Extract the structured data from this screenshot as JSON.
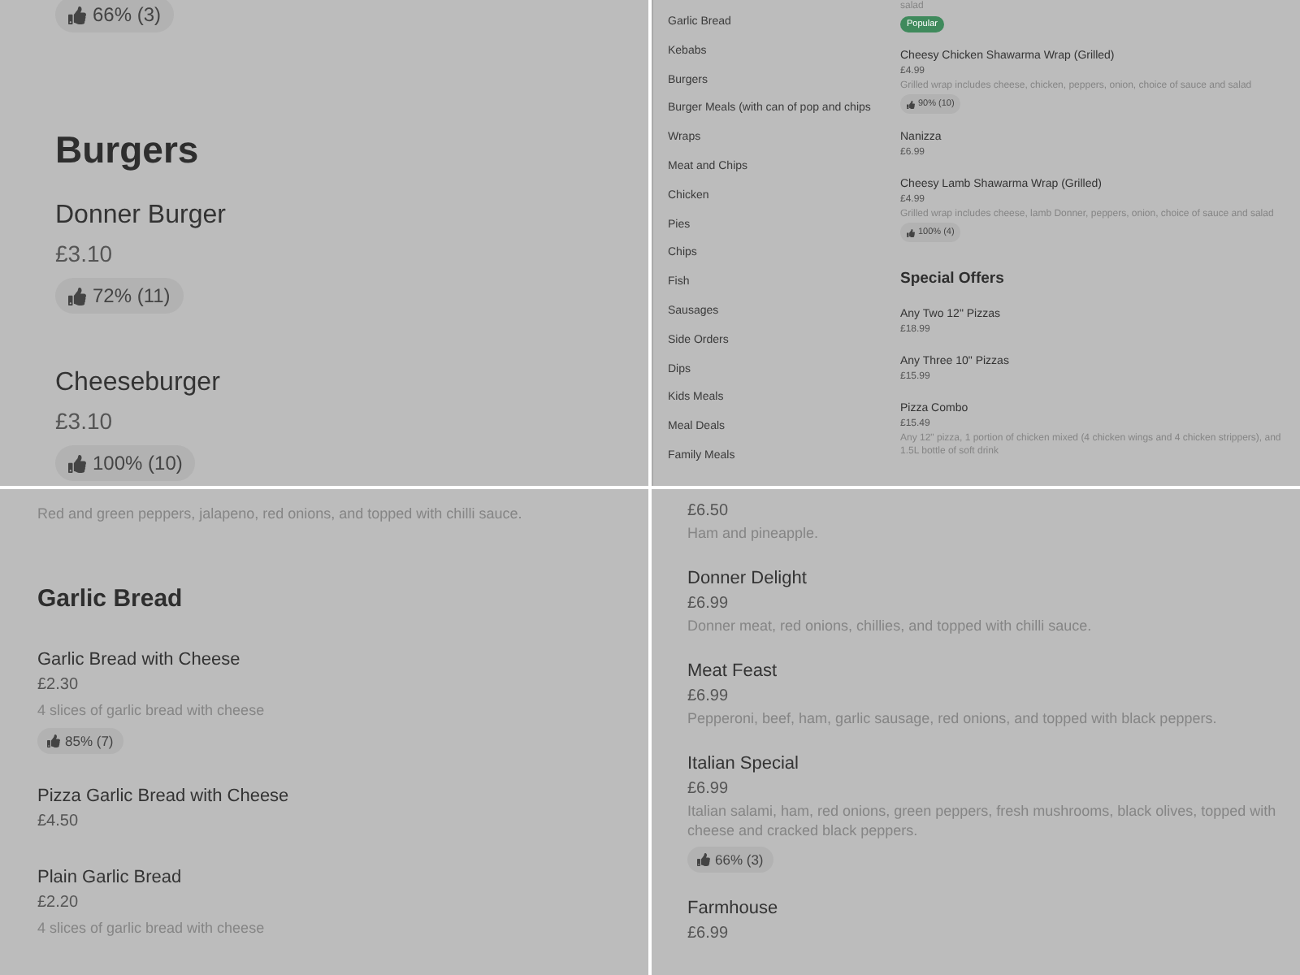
{
  "panels": [
    {
      "blocks": [
        {
          "kind": "rating",
          "rating": "66% (3)"
        },
        {
          "kind": "heading",
          "text": "Burgers"
        },
        {
          "kind": "item",
          "name": "Donner Burger",
          "price": "£3.10",
          "rating": "72% (11)"
        },
        {
          "kind": "item",
          "name": "Cheeseburger",
          "price": "£3.10",
          "rating": "100% (10)"
        }
      ]
    },
    {
      "sidebar": [
        "Garlic Bread",
        "Kebabs",
        "Burgers",
        "Burger Meals (with can of pop and chips",
        "Wraps",
        "Meat and Chips",
        "Chicken",
        "Pies",
        "Chips",
        "Fish",
        "Sausages",
        "Side Orders",
        "Dips",
        "Kids Meals",
        "Meal Deals",
        "Family Meals"
      ],
      "blocks": [
        {
          "kind": "description",
          "text": "salad"
        },
        {
          "kind": "badge",
          "text": "Popular",
          "color": "#3f8a5c"
        },
        {
          "kind": "item",
          "name": "Cheesy Chicken Shawarma Wrap (Grilled)",
          "price": "£4.99",
          "description": "Grilled wrap includes cheese, chicken, peppers, onion, choice of sauce and salad",
          "rating": "90% (10)"
        },
        {
          "kind": "item",
          "name": "Nanizza",
          "price": "£6.99"
        },
        {
          "kind": "item",
          "name": "Cheesy Lamb Shawarma Wrap (Grilled)",
          "price": "£4.99",
          "description": "Grilled wrap includes cheese, lamb Donner, peppers, onion, choice of sauce and salad",
          "rating": "100% (4)"
        },
        {
          "kind": "heading",
          "text": "Special Offers"
        },
        {
          "kind": "item",
          "name": "Any Two 12\" Pizzas",
          "price": "£18.99"
        },
        {
          "kind": "item",
          "name": "Any Three 10\" Pizzas",
          "price": "£15.99"
        },
        {
          "kind": "item",
          "name": "Pizza Combo",
          "price": "£15.49",
          "description": "Any 12\" pizza, 1 portion of chicken mixed (4 chicken wings and 4 chicken strippers), and 1.5L bottle of soft drink"
        }
      ]
    },
    {
      "blocks": [
        {
          "kind": "description",
          "text": "Red and green peppers, jalapeno, red onions, and topped with chilli sauce."
        },
        {
          "kind": "heading",
          "text": "Garlic Bread"
        },
        {
          "kind": "item",
          "name": "Garlic Bread with Cheese",
          "price": "£2.30",
          "description": "4 slices of garlic bread with cheese",
          "rating": "85% (7)"
        },
        {
          "kind": "item",
          "name": "Pizza Garlic Bread with Cheese",
          "price": "£4.50"
        },
        {
          "kind": "item",
          "name": "Plain Garlic Bread",
          "price": "£2.20",
          "description": "4 slices of garlic bread with cheese"
        }
      ]
    },
    {
      "blocks": [
        {
          "kind": "item",
          "price": "£6.50",
          "description": "Ham and pineapple."
        },
        {
          "kind": "item",
          "name": "Donner Delight",
          "price": "£6.99",
          "description": "Donner meat, red onions, chillies, and topped with chilli sauce."
        },
        {
          "kind": "item",
          "name": "Meat Feast",
          "price": "£6.99",
          "description": "Pepperoni, beef, ham, garlic sausage, red onions, and topped with black peppers."
        },
        {
          "kind": "item",
          "name": "Italian Special",
          "price": "£6.99",
          "description": "Italian salami, ham, red onions, green peppers, fresh mushrooms, black olives, topped with cheese and cracked black peppers.",
          "rating": "66% (3)"
        },
        {
          "kind": "item",
          "name": "Farmhouse",
          "price": "£6.99"
        }
      ]
    }
  ]
}
